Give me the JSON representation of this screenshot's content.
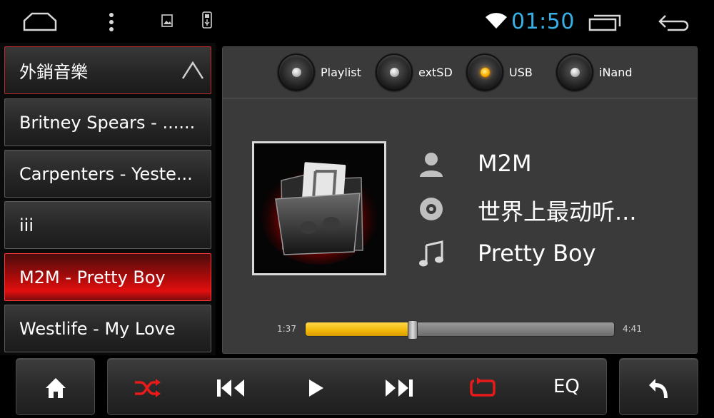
{
  "status_bar": {
    "time": "01:50",
    "icons": [
      "home-nav-icon",
      "overflow-menu-icon",
      "image-notification-icon",
      "usb-notification-icon",
      "wifi-icon",
      "recent-apps-icon",
      "back-nav-icon"
    ]
  },
  "playlist": {
    "header": "外銷音樂",
    "items": [
      {
        "label": "Britney Spears - ......"
      },
      {
        "label": "Carpenters - Yeste..."
      },
      {
        "label": "iii"
      },
      {
        "label": "M2M - Pretty Boy",
        "active": true
      },
      {
        "label": "Westlife - My Love"
      }
    ]
  },
  "sources": [
    {
      "label": "Playlist",
      "selected": false
    },
    {
      "label": "extSD",
      "selected": false
    },
    {
      "label": "USB",
      "selected": true
    },
    {
      "label": "iNand",
      "selected": false
    }
  ],
  "now_playing": {
    "artist": "M2M",
    "album": "世界上最动听...",
    "title": "Pretty Boy"
  },
  "progress": {
    "elapsed": "1:37",
    "total": "4:41",
    "fraction": 0.345
  },
  "controls": {
    "eq_label": "EQ"
  },
  "colors": {
    "clock": "#35b1e8",
    "active_item": "#d80d0d",
    "progress": "#f2b808",
    "shuffle_repeat": "#e81a1a"
  }
}
